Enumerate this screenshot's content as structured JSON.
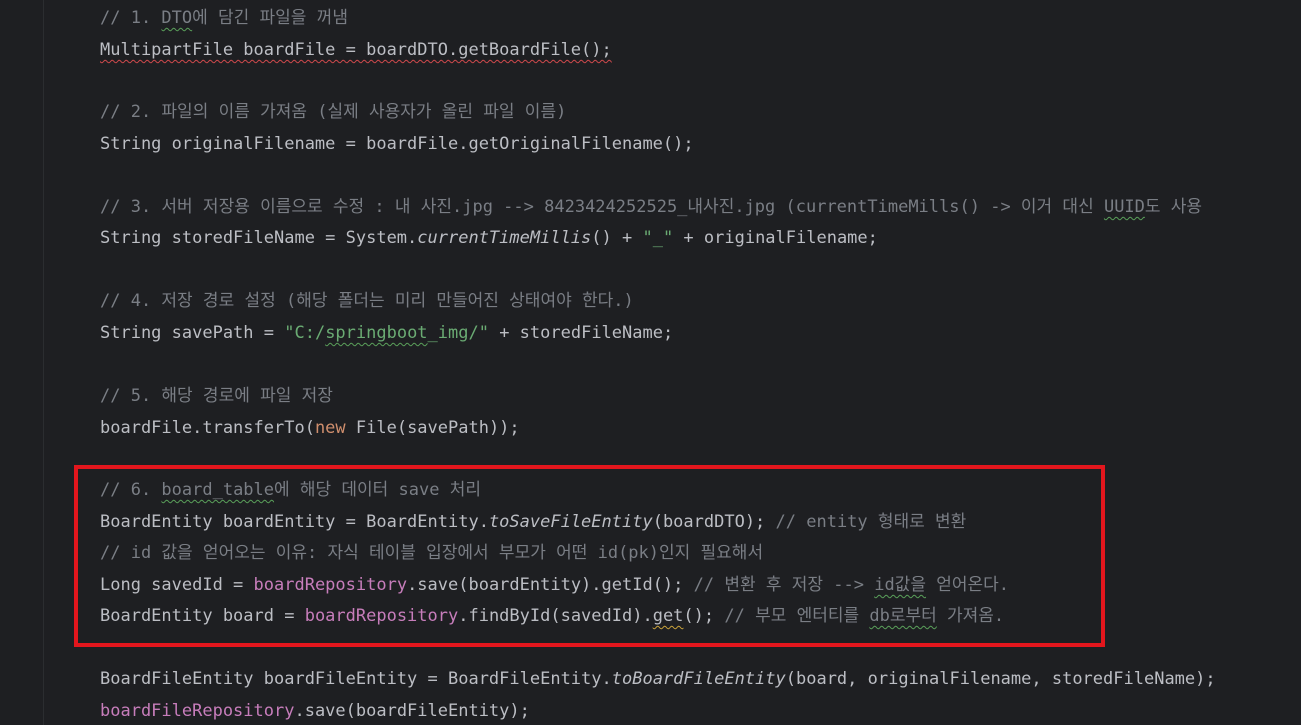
{
  "code": {
    "l1": [
      "// 1. ",
      "DTO",
      "에 담긴 파일을 꺼냄"
    ],
    "l2": [
      "MultipartFile boardFile = boardDTO.getBoardFile();"
    ],
    "l3": [
      "// 2. 파일의 이름 가져옴 (실제 사용자가 올린 파일 이름)"
    ],
    "l4": [
      "String originalFilename = boardFile.getOriginalFilename();"
    ],
    "l5": [
      "// 3. 서버 저장용 이름으로 수정 : 내 사진.jpg --> 8423424252525_내사진.jpg (currentTimeMills() -> 이거 대신 ",
      "UUID",
      "도 사용"
    ],
    "l6": [
      "String storedFileName = System.",
      "currentTimeMillis",
      "() + ",
      "\"_\"",
      " + originalFilename;"
    ],
    "l7": [
      "// 4. 저장 경로 설정 (해당 폴더는 미리 만들어진 상태여야 한다.)"
    ],
    "l8": [
      "String savePath = ",
      "\"C:/",
      "springboot",
      "_img/\"",
      " + storedFileName;"
    ],
    "l9": [
      "// 5. 해당 경로에 파일 저장"
    ],
    "l10": [
      "boardFile.transferTo(",
      "new",
      " File(savePath));"
    ],
    "l11": [
      "// 6. ",
      "board_table",
      "에 해당 데이터 save 처리"
    ],
    "l12": [
      "BoardEntity boardEntity = BoardEntity.",
      "toSaveFileEntity",
      "(boardDTO); ",
      "// entity 형태로 변환"
    ],
    "l13": [
      "// id 값을 얻어오는 이유: 자식 테이블 입장에서 부모가 어떤 id(pk)인지 필요해서"
    ],
    "l14": [
      "Long savedId = ",
      "boardRepository",
      ".save(boardEntity).getId(); ",
      "// 변환 후 저장 --> ",
      "id값을",
      " 얻어온다."
    ],
    "l15": [
      "BoardEntity board = ",
      "boardRepository",
      ".findById(savedId).",
      "get",
      "(); ",
      "// 부모 엔터티를 ",
      "db로부터",
      " 가져옴."
    ],
    "l16": [
      "BoardFileEntity boardFileEntity = BoardFileEntity.",
      "toBoardFileEntity",
      "(board, originalFilename, storedFileName);"
    ],
    "l17": [
      "boardFileRepository",
      ".save(boardFileEntity);"
    ]
  }
}
